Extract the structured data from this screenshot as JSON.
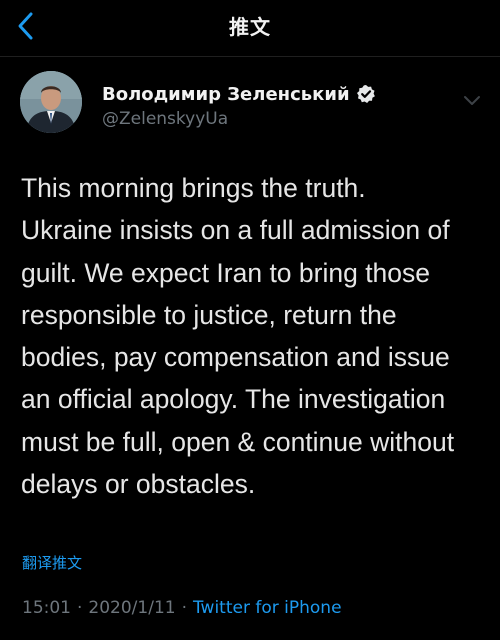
{
  "nav": {
    "title": "推文"
  },
  "author": {
    "display_name": "Володимир Зеленський",
    "handle": "@ZelenskyyUa",
    "verified": true
  },
  "tweet": {
    "text": "This morning brings the truth.\nUkraine insists on a full admission of\nguilt. We expect Iran to bring those\nresponsible to justice, return the\nbodies, pay compensation and issue\nan official apology. The investigation\nmust be full, open & continue without\ndelays or obstacles.",
    "translate_label": "翻译推文",
    "time": "15:01",
    "separator": "·",
    "date": "2020/1/11",
    "source": "Twitter for iPhone"
  },
  "colors": {
    "background": "#000000",
    "accent": "#1d9bf0",
    "secondary_text": "#6e767d",
    "primary_text": "#e7e9ea"
  },
  "icons": {
    "back": "chevron-left-icon",
    "verified": "verified-badge-icon",
    "more": "chevron-down-icon"
  }
}
